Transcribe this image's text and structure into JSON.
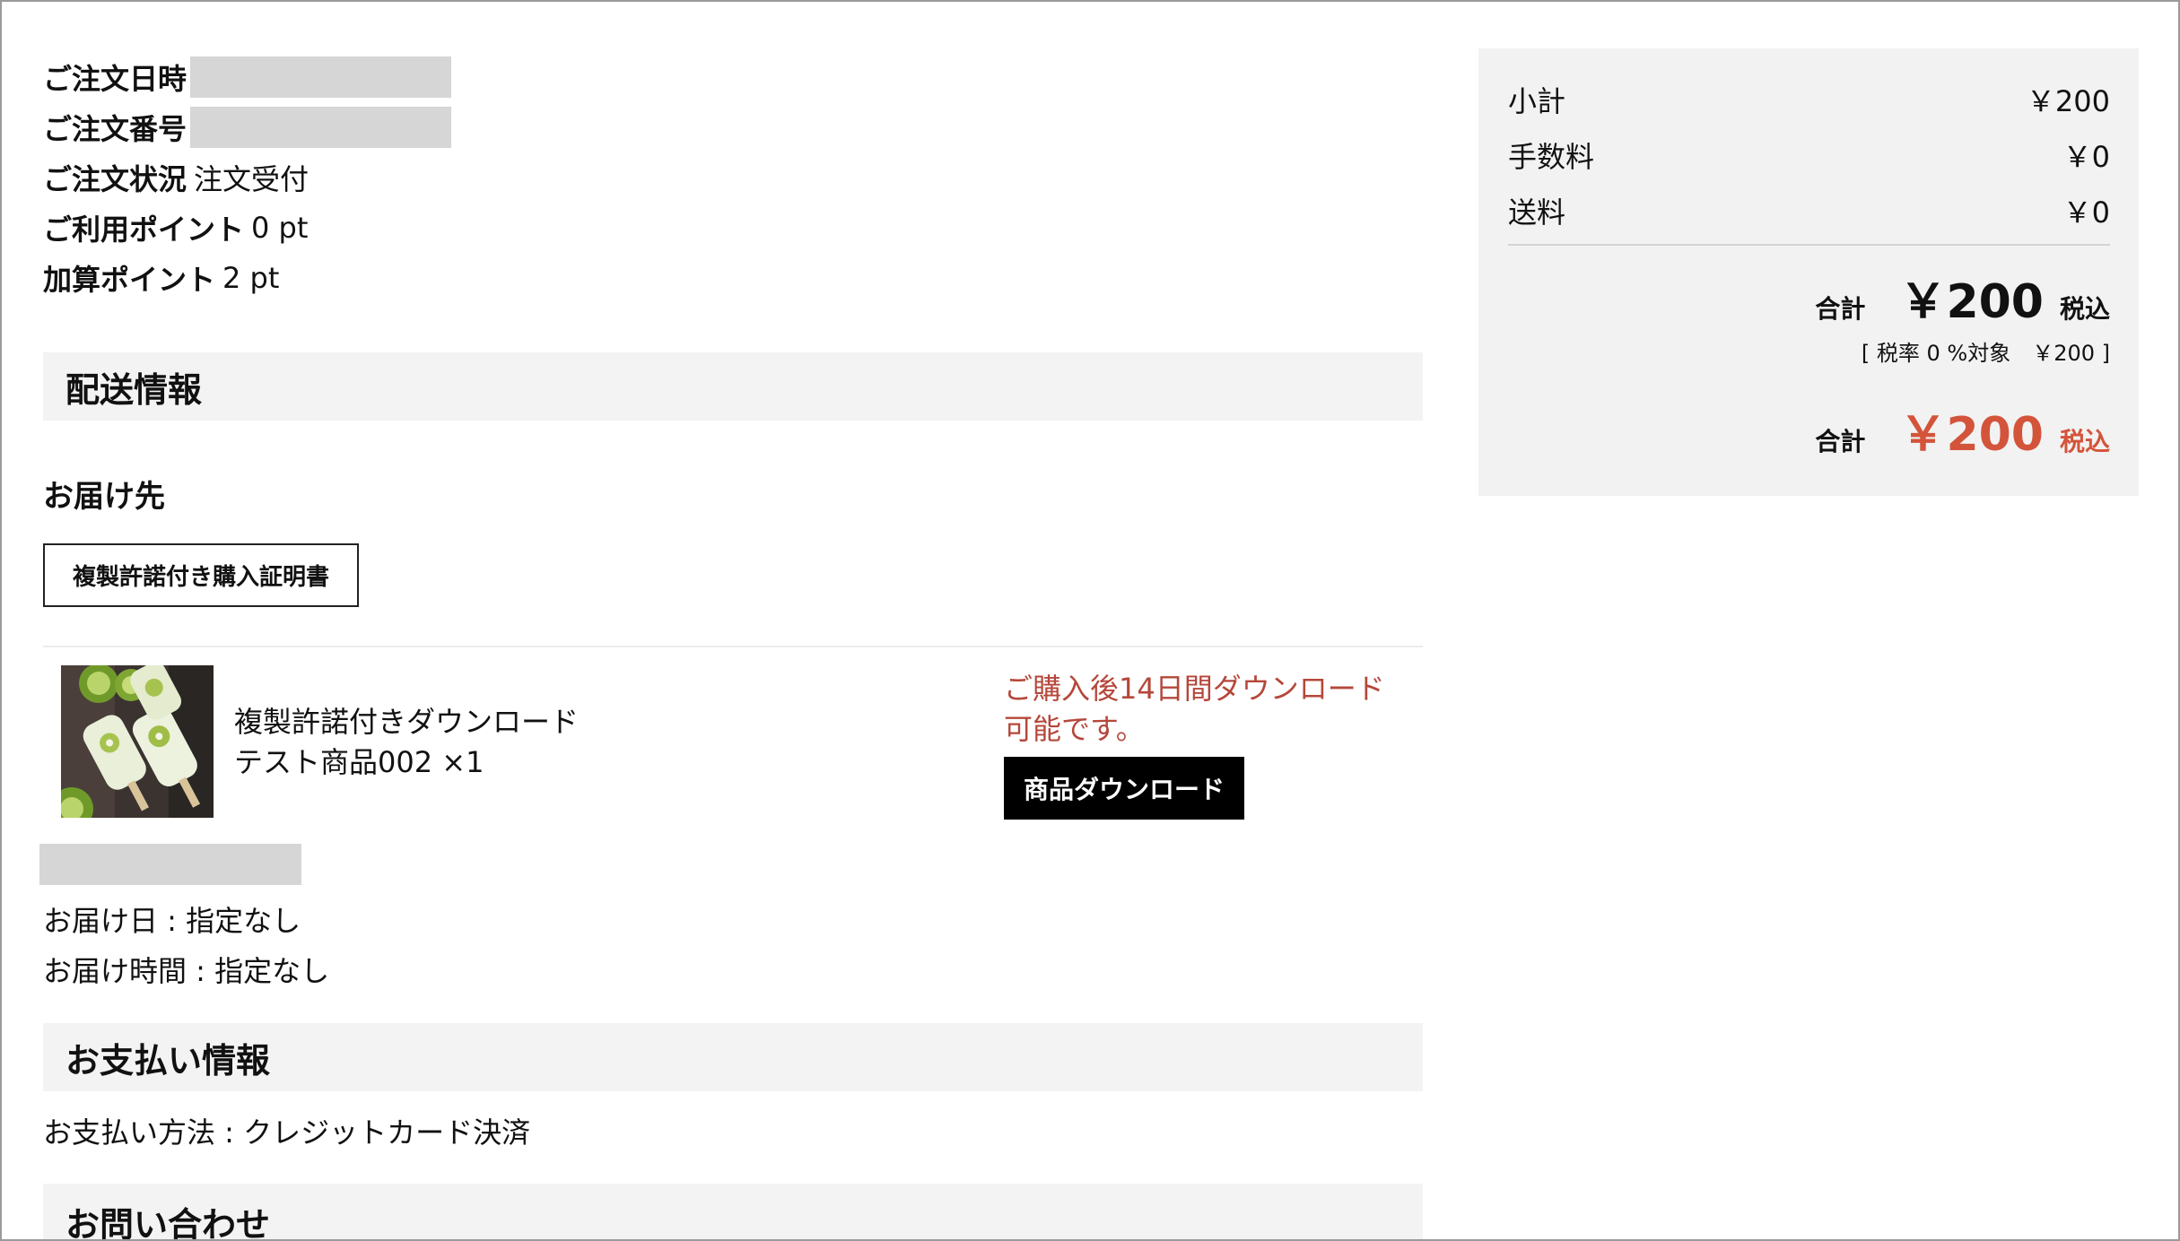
{
  "order": {
    "date_label": "ご注文日時",
    "number_label": "ご注文番号",
    "status_label": "ご注文状況",
    "status_value": "注文受付",
    "used_points_label": "ご利用ポイント",
    "used_points_value": "0 pt",
    "added_points_label": "加算ポイント",
    "added_points_value": "2 pt"
  },
  "delivery": {
    "section_title": "配送情報",
    "destination_title": "お届け先",
    "certificate_button": "複製許諾付き購入証明書",
    "item": {
      "name_line1": "複製許諾付きダウンロード",
      "name_line2": "テスト商品002 ×1",
      "download_note_line1": "ご購入後14日間ダウンロード",
      "download_note_line2": "可能です。",
      "download_button": "商品ダウンロード"
    },
    "delivery_date": "お届け日 : 指定なし",
    "delivery_time": "お届け時間 : 指定なし"
  },
  "payment": {
    "section_title": "お支払い情報",
    "method": "お支払い方法 : クレジットカード決済"
  },
  "inquiry": {
    "section_title": "お問い合わせ"
  },
  "summary": {
    "subtotal_label": "小計",
    "subtotal_value": "￥200",
    "fee_label": "手数料",
    "fee_value": "￥0",
    "shipping_label": "送料",
    "shipping_value": "￥0",
    "total_label": "合計",
    "total_value": "￥200",
    "tax_included": "税込",
    "tax_note": "[ 税率 0 %対象　￥200 ]",
    "grand_total_label": "合計",
    "grand_total_value": "￥200",
    "grand_tax_included": "税込"
  },
  "colors": {
    "accent_red": "#d3543b",
    "note_red": "#b5473a",
    "section_bg": "#f3f3f3",
    "redaction": "#d6d6d6"
  }
}
